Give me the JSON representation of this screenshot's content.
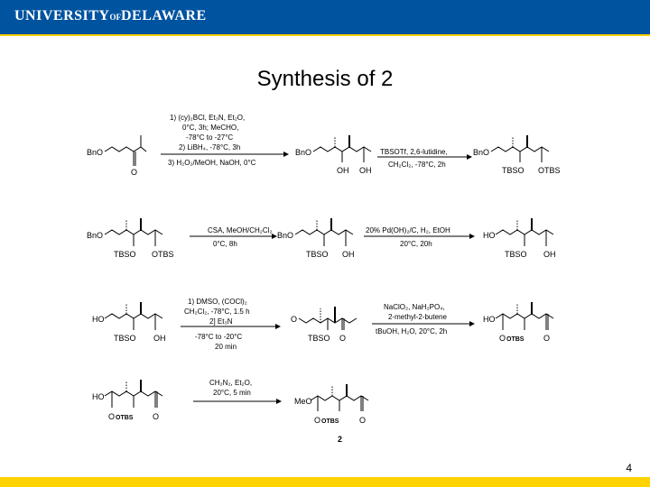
{
  "header": {
    "logo_text_1": "UNIVERSITY",
    "logo_text_of": "OF",
    "logo_text_2": "DELAWARE",
    "header_color": "#00539f",
    "accent_color": "#ffd200"
  },
  "slide": {
    "title": "Synthesis of 2",
    "page_number": "4"
  },
  "rows": [
    {
      "molecules": [
        {
          "labels": [
            "BnO",
            "O"
          ]
        },
        {
          "labels": [
            "BnO",
            "OH",
            "OH"
          ]
        },
        {
          "labels": [
            "BnO",
            "TBSO",
            "OTBS"
          ]
        }
      ],
      "arrows": [
        {
          "above": [
            "1) (cy)₂BCl, Et₃N, Et₂O,",
            "0°C, 3h; MeCHO,",
            "-78°C to -27°C",
            "2) LiBH₄, -78°C, 3h"
          ],
          "below": [
            "3) H₂O₂/MeOH, NaOH, 0°C"
          ]
        },
        {
          "above": [
            "TBSOTf, 2,6-lutidine,"
          ],
          "below": [
            "CH₂Cl₂, -78°C, 2h"
          ]
        }
      ]
    },
    {
      "molecules": [
        {
          "labels": [
            "BnO",
            "TBSO",
            "OTBS"
          ]
        },
        {
          "labels": [
            "BnO",
            "TBSO",
            "OH"
          ]
        },
        {
          "labels": [
            "HO",
            "TBSO",
            "OH"
          ]
        }
      ],
      "arrows": [
        {
          "above": [
            "CSA, MeOH/CH₂Cl₂"
          ],
          "below": [
            "0°C, 8h"
          ]
        },
        {
          "above": [
            "20% Pd(OH)₂/C, H₂, EtOH"
          ],
          "below": [
            "20°C, 20h"
          ]
        }
      ]
    },
    {
      "molecules": [
        {
          "labels": [
            "HO",
            "TBSO",
            "OH"
          ]
        },
        {
          "labels": [
            "O",
            "TBSO",
            "O"
          ]
        },
        {
          "labels": [
            "HO",
            "O",
            "OTBS",
            "O"
          ]
        }
      ],
      "arrows": [
        {
          "above": [
            "1) DMSO, (COCl)₂",
            "CH₂Cl₂, -78°C, 1.5 h",
            "2] Et₃N"
          ],
          "below": [
            "-78°C to -20°C",
            "20 min"
          ]
        },
        {
          "above": [
            "NaClO₂, NaH₂PO₄,",
            "2-methyl-2-butene"
          ],
          "below": [
            "tBuOH, H₂O, 20°C, 2h"
          ]
        }
      ]
    },
    {
      "molecules": [
        {
          "labels": [
            "HO",
            "O",
            "OTBS",
            "O"
          ]
        },
        {
          "labels": [
            "MeO",
            "O",
            "OTBS",
            "O"
          ]
        }
      ],
      "arrows": [
        {
          "above": [
            "CH₂N₂, Et₂O,",
            "20°C, 5 min"
          ],
          "below": []
        }
      ],
      "compound_label": "2"
    }
  ]
}
